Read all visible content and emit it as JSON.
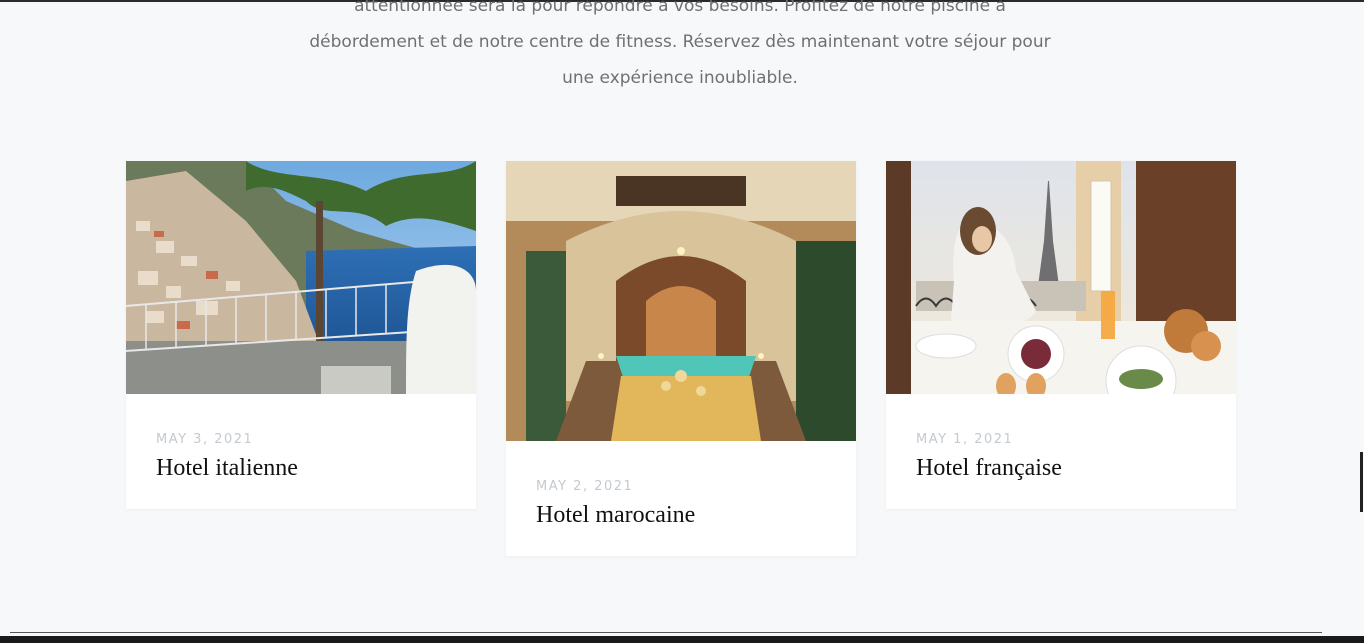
{
  "intro": {
    "line1": "attentionnée sera là pour répondre à vos besoins. Profitez de notre piscine à",
    "line2": "débordement et de notre centre de fitness. Réservez dès maintenant votre séjour pour",
    "line3": "une expérience inoubliable."
  },
  "cards": [
    {
      "date": "MAY 3, 2021",
      "title": "Hotel italienne"
    },
    {
      "date": "MAY 2, 2021",
      "title": "Hotel marocaine"
    },
    {
      "date": "MAY 1, 2021",
      "title": "Hotel française"
    }
  ]
}
